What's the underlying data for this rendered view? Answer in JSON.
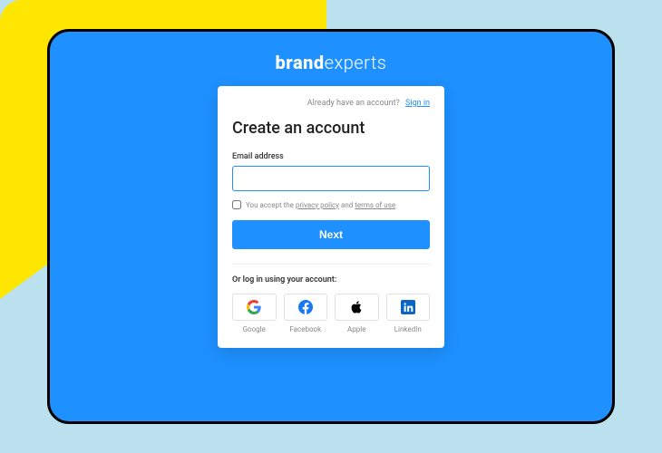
{
  "logo": {
    "bold": "brand",
    "thin": "experts"
  },
  "signin": {
    "prompt": "Already have an account?",
    "link": "Sign in"
  },
  "title": "Create an account",
  "email": {
    "label": "Email address",
    "value": ""
  },
  "terms": {
    "prefix": "You accept the",
    "privacy": "privacy policy",
    "and": "and",
    "tos": "terms of use"
  },
  "next": "Next",
  "social": {
    "label": "Or log in using your account:",
    "providers": {
      "google": "Google",
      "facebook": "Facebook",
      "apple": "Apple",
      "linkedin": "LinkedIn"
    }
  }
}
